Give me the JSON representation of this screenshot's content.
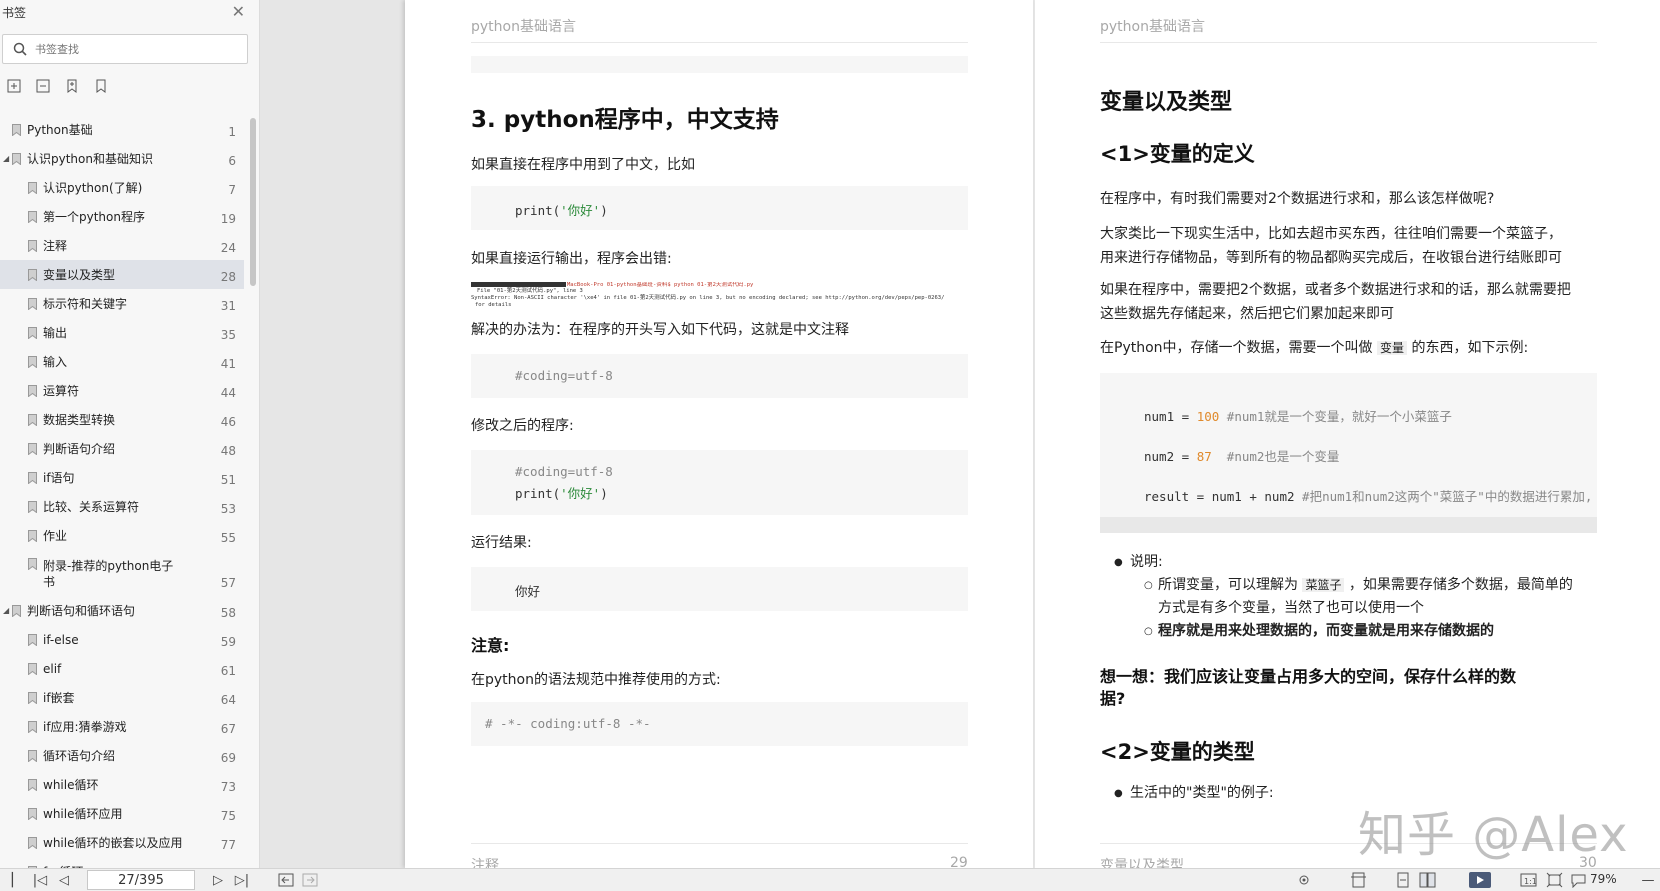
{
  "sidebar": {
    "title": "书签",
    "search_placeholder": "书签查找",
    "bookmarks": [
      {
        "label": "Python基础",
        "page": "1",
        "level": 0,
        "caret": ""
      },
      {
        "label": "认识python和基础知识",
        "page": "6",
        "level": 0,
        "caret": "◢"
      },
      {
        "label": "认识python(了解)",
        "page": "7",
        "level": 1
      },
      {
        "label": "第一个python程序",
        "page": "19",
        "level": 1
      },
      {
        "label": "注释",
        "page": "24",
        "level": 1
      },
      {
        "label": "变量以及类型",
        "page": "28",
        "level": 1,
        "selected": true
      },
      {
        "label": "标示符和关键字",
        "page": "31",
        "level": 1
      },
      {
        "label": "输出",
        "page": "35",
        "level": 1
      },
      {
        "label": "输入",
        "page": "41",
        "level": 1
      },
      {
        "label": "运算符",
        "page": "44",
        "level": 1
      },
      {
        "label": "数据类型转换",
        "page": "46",
        "level": 1
      },
      {
        "label": "判断语句介绍",
        "page": "48",
        "level": 1
      },
      {
        "label": "if语句",
        "page": "51",
        "level": 1
      },
      {
        "label": "比较、关系运算符",
        "page": "53",
        "level": 1
      },
      {
        "label": "作业",
        "page": "55",
        "level": 1
      },
      {
        "label": "附录-推荐的python电子书",
        "page": "57",
        "level": 1,
        "tall": true
      },
      {
        "label": "判断语句和循环语句",
        "page": "58",
        "level": 0,
        "caret": "◢"
      },
      {
        "label": "if-else",
        "page": "59",
        "level": 1
      },
      {
        "label": "elif",
        "page": "61",
        "level": 1
      },
      {
        "label": "if嵌套",
        "page": "64",
        "level": 1
      },
      {
        "label": "if应用:猜拳游戏",
        "page": "67",
        "level": 1
      },
      {
        "label": "循环语句介绍",
        "page": "69",
        "level": 1
      },
      {
        "label": "while循环",
        "page": "73",
        "level": 1
      },
      {
        "label": "while循环应用",
        "page": "75",
        "level": 1
      },
      {
        "label": "while循环的嵌套以及应用",
        "page": "77",
        "level": 1
      },
      {
        "label": "for循环",
        "page": "",
        "level": 1
      }
    ]
  },
  "left_page": {
    "header": "python基础语言",
    "heading": "3. python程序中，中文支持",
    "p1": "如果直接在程序中用到了中文，比如",
    "code1_pre": "print(",
    "code1_str": "'你好'",
    "code1_post": ")",
    "p2": "如果直接运行输出，程序会出错:",
    "err_line1": "MacBook-Pro 01-python基础班-资料$ python 01-第2天测试代码.py",
    "err_line2": "  File \"01-第2天测试代码.py\", line 3",
    "err_line3": "SyntaxError: Non-ASCII character '\\xe4' in file 01-第2天测试代码.py on line 3, but no encoding declared; see http://python.org/dev/peps/pep-0263/",
    "err_line4": "  for details",
    "p3": "解决的办法为：在程序的开头写入如下代码，这就是中文注释",
    "code2": "#coding=utf-8",
    "p4": "修改之后的程序:",
    "code3_l1": "#coding=utf-8",
    "code3_l2_pre": "print(",
    "code3_l2_str": "'你好'",
    "code3_l2_post": ")",
    "p5": "运行结果:",
    "code4": "你好",
    "note_heading": "注意:",
    "p6": "在python的语法规范中推荐使用的方式:",
    "code5": "# -*- coding:utf-8 -*-",
    "footer_left": "注释",
    "footer_right": "29"
  },
  "right_page": {
    "header": "python基础语言",
    "h_main": "变量以及类型",
    "h_1": "<1>变量的定义",
    "p1": "在程序中，有时我们需要对2个数据进行求和，那么该怎样做呢?",
    "p2a": "大家类比一下现实生活中，比如去超市买东西，往往咱们需要一个菜篮子，",
    "p2b": "用来进行存储物品，等到所有的物品都购买完成后，在收银台进行结账即可",
    "p3a": "如果在程序中，需要把2个数据，或者多个数据进行求和的话，那么就需要把",
    "p3b": "这些数据先存储起来，然后把它们累加起来即可",
    "p4_pre": "在Python中，存储一个数据，需要一个叫做",
    "p4_code": "变量",
    "p4_post": "的东西，如下示例:",
    "c1_pre": "num1 = ",
    "c1_num": "100",
    "c1_cmt": " #num1就是一个变量，就好一个小菜篮子",
    "c2_pre": "num2 = ",
    "c2_num": "87",
    "c2_cmt": "  #num2也是一个变量",
    "c3_pre": "result = num1 + num2 ",
    "c3_cmt": "#把num1和num2这两个\"菜篮子\"中的数据进行累加,",
    "b1": "说明:",
    "b1a_pre": "所谓变量，可以理解为",
    "b1a_code": "菜篮子",
    "b1a_post": "，如果需要存储多个数据，最简单的",
    "b1a_cont": "方式是有多个变量，当然了也可以使用一个",
    "b1b": "程序就是用来处理数据的，而变量就是用来存储数据的",
    "think_a": "想一想：我们应该让变量占用多大的空间，保存什么样的数",
    "think_b": "据?",
    "h_2": "<2>变量的类型",
    "b2": "生活中的\"类型\"的例子:",
    "footer_left": "变量以及类型",
    "footer_right": "30"
  },
  "watermark": "知乎 @Alex",
  "bottombar": {
    "page_indicator": "27/395",
    "zoom": "79%"
  }
}
